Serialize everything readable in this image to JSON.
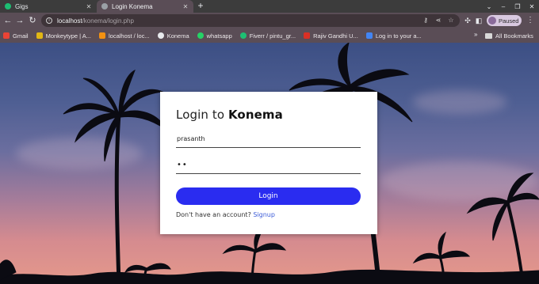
{
  "browser": {
    "tabs": [
      {
        "label": "Gigs",
        "active": false,
        "favicon_color": "#1dbf73"
      },
      {
        "label": "Login Konema",
        "active": true,
        "favicon_color": "#9aa0a6"
      }
    ],
    "url_host": "localhost",
    "url_path": "/konema/login.php",
    "profile_status": "Paused",
    "bookmarks": [
      {
        "label": "Gmail",
        "color": "#ea4335"
      },
      {
        "label": "Monkeytype | A...",
        "color": "#e2b714"
      },
      {
        "label": "localhost / loc...",
        "color": "#f29111"
      },
      {
        "label": "Konema",
        "color": "#e8eaed"
      },
      {
        "label": "whatsapp",
        "color": "#25d366"
      },
      {
        "label": "Fiverr / pintu_gr...",
        "color": "#1dbf73"
      },
      {
        "label": "Rajiv Gandhi U...",
        "color": "#d93025"
      },
      {
        "label": "Log in to your a...",
        "color": "#4285f4"
      }
    ],
    "all_bookmarks_label": "All Bookmarks",
    "icons": {
      "back": "arrow-left-icon",
      "forward": "arrow-right-icon",
      "reload": "reload-icon",
      "key": "key-icon",
      "share": "share-icon",
      "star": "star-icon",
      "extensions": "puzzle-icon",
      "sidepanel": "sidepanel-icon"
    }
  },
  "login": {
    "title_prefix": "Login to",
    "title_brand": "Konema",
    "username_value": "prasanth",
    "password_value": "••",
    "button_label": "Login",
    "signup_prompt": "Don't have an account?",
    "signup_link": "Signup",
    "button_color": "#2a2cf0"
  }
}
